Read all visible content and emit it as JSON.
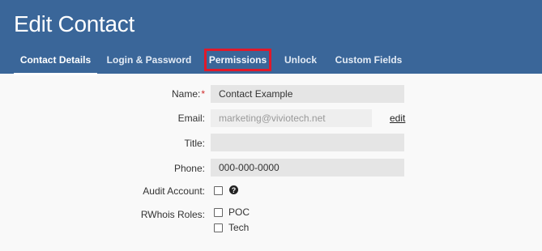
{
  "header": {
    "title": "Edit Contact",
    "tabs": [
      {
        "label": "Contact Details",
        "active": true
      },
      {
        "label": "Login & Password",
        "active": false
      },
      {
        "label": "Permissions",
        "active": false,
        "highlighted": true
      },
      {
        "label": "Unlock",
        "active": false
      },
      {
        "label": "Custom Fields",
        "active": false
      }
    ]
  },
  "form": {
    "name": {
      "label": "Name:",
      "required_mark": "*",
      "value": "Contact Example"
    },
    "email": {
      "label": "Email:",
      "value": "marketing@viviotech.net",
      "edit_link": "edit"
    },
    "title": {
      "label": "Title:",
      "value": ""
    },
    "phone": {
      "label": "Phone:",
      "value": "000-000-0000"
    },
    "audit": {
      "label": "Audit Account:",
      "checked": false,
      "help_icon": "question-circle-icon"
    },
    "rwhois": {
      "label": "RWhois Roles:",
      "options": [
        {
          "label": "POC",
          "checked": false
        },
        {
          "label": "Tech",
          "checked": false
        }
      ]
    }
  },
  "colors": {
    "header_bg": "#3a6699",
    "highlight_border": "#e0192a",
    "required": "#d02b2b"
  }
}
